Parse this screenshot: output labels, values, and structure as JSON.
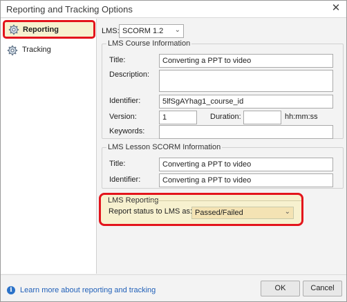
{
  "window": {
    "title": "Reporting and Tracking Options",
    "close_glyph": "✕"
  },
  "sidebar": {
    "items": [
      {
        "label": "Reporting",
        "icon": "gear-icon",
        "selected": true
      },
      {
        "label": "Tracking",
        "icon": "gear-icon",
        "selected": false
      }
    ]
  },
  "lms": {
    "label": "LMS:",
    "selected": "SCORM 1.2"
  },
  "course": {
    "legend": "LMS Course Information",
    "title_label": "Title:",
    "title_value": "Converting a PPT to video",
    "description_label": "Description:",
    "description_value": "",
    "identifier_label": "Identifier:",
    "identifier_value": "5lfSgAYhag1_course_id",
    "version_label": "Version:",
    "version_value": "1",
    "duration_label": "Duration:",
    "duration_value": "",
    "duration_unit": "hh:mm:ss",
    "keywords_label": "Keywords:",
    "keywords_value": ""
  },
  "lesson": {
    "legend": "LMS Lesson SCORM Information",
    "title_label": "Title:",
    "title_value": "Converting a PPT to video",
    "identifier_label": "Identifier:",
    "identifier_value": "Converting a PPT to video"
  },
  "reporting": {
    "legend": "LMS Reporting",
    "status_label": "Report status to LMS as:",
    "status_value": "Passed/Failed",
    "highlight_color": "#e3141c",
    "highlight_fill": "#f7f1cf"
  },
  "footer": {
    "help_link": "Learn more about reporting and tracking",
    "info_glyph": "i",
    "ok_label": "OK",
    "cancel_label": "Cancel"
  }
}
